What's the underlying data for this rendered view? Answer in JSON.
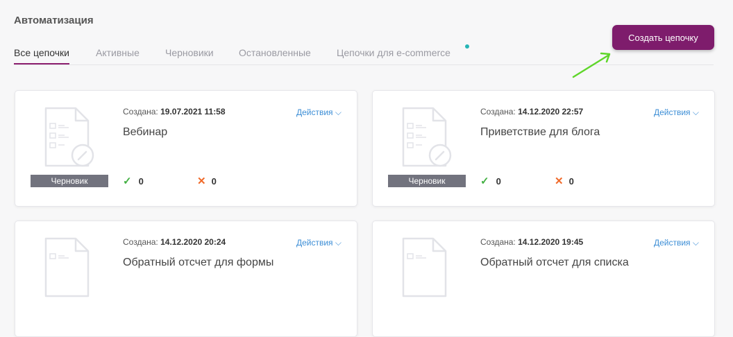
{
  "page": {
    "title": "Автоматизация"
  },
  "tabs": [
    {
      "label": "Все цепочки",
      "active": true
    },
    {
      "label": "Активные"
    },
    {
      "label": "Черновики"
    },
    {
      "label": "Остановленные"
    },
    {
      "label": "Цепочки для e-commerce"
    }
  ],
  "create_button": {
    "label": "Создать цепочку"
  },
  "colors": {
    "accent": "#7e1c6c",
    "link": "#3c8ed6",
    "ok": "#43b043",
    "fail": "#f06a2a",
    "badge": "#72737e",
    "dot": "#26b5b5",
    "arrow": "#5fd62a"
  },
  "cards": [
    {
      "created_label": "Создана:",
      "created_value": "19.07.2021 11:58",
      "name": "Вебинар",
      "actions": "Действия",
      "badge": "Черновик",
      "ok_count": "0",
      "fail_count": "0"
    },
    {
      "created_label": "Создана:",
      "created_value": "14.12.2020 22:57",
      "name": "Приветствие для блога",
      "actions": "Действия",
      "badge": "Черновик",
      "ok_count": "0",
      "fail_count": "0"
    },
    {
      "created_label": "Создана:",
      "created_value": "14.12.2020 20:24",
      "name": "Обратный отсчет для формы",
      "actions": "Действия"
    },
    {
      "created_label": "Создана:",
      "created_value": "14.12.2020 19:45",
      "name": "Обратный отсчет для списка",
      "actions": "Действия"
    }
  ]
}
